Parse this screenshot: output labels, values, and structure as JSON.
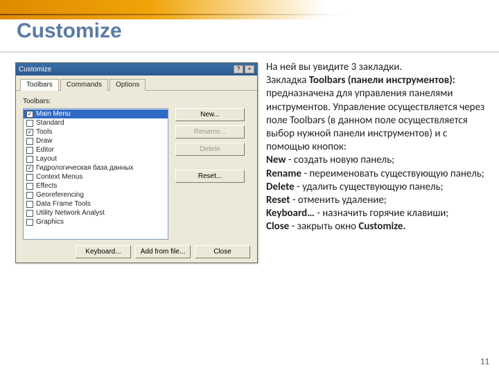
{
  "page": {
    "title": "Customize",
    "number": "11"
  },
  "dialog": {
    "title": "Customize",
    "help_icon": "?",
    "close_icon": "×",
    "tabs": {
      "t0": "Toolbars",
      "t1": "Commands",
      "t2": "Options"
    },
    "label": "Toolbars:",
    "list": [
      {
        "label": "Main Menu",
        "checked": true,
        "selected": true
      },
      {
        "label": "Standard",
        "checked": false
      },
      {
        "label": "Tools",
        "checked": true
      },
      {
        "label": "Draw",
        "checked": false
      },
      {
        "label": "Editor",
        "checked": false
      },
      {
        "label": "Layout",
        "checked": false
      },
      {
        "label": "Гидрологическая база данных",
        "checked": true
      },
      {
        "label": "Context Menus",
        "checked": false
      },
      {
        "label": "Effects",
        "checked": false
      },
      {
        "label": "Georeferencing",
        "checked": false
      },
      {
        "label": "Data Frame Tools",
        "checked": false
      },
      {
        "label": "Utility Network Analyst",
        "checked": false
      },
      {
        "label": "Graphics",
        "checked": false
      }
    ],
    "buttons": {
      "new": "New...",
      "rename": "Rename...",
      "delete": "Delete",
      "reset": "Reset...",
      "keyboard": "Keyboard...",
      "addfrom": "Add from file...",
      "close": "Close"
    }
  },
  "desc": {
    "l0": "На ней вы увидите 3 закладки.",
    "l1a": "Закладка ",
    "l1b": "Toolbars (панели инструментов):",
    "l2": "предназначена для управления панелями инструментов. Управление осуществляется через поле Toolbars (в данном поле осуществляется выбор нужной панели инструментов) и с помощью кнопок:",
    "l3a": "New",
    "l3b": " - создать новую панель;",
    "l4a": "Rename",
    "l4b": " - переименовать существующую панель;",
    "l5a": "Delete",
    "l5b": " - удалить существующую панель;",
    "l6a": "Reset",
    "l6b": " - отменить удаление;",
    "l7a": "Keyboard…",
    "l7b": " - назначить горячие клавиши;",
    "l8a": "Close",
    "l8b": " - закрыть окно ",
    "l8c": "Customize."
  }
}
